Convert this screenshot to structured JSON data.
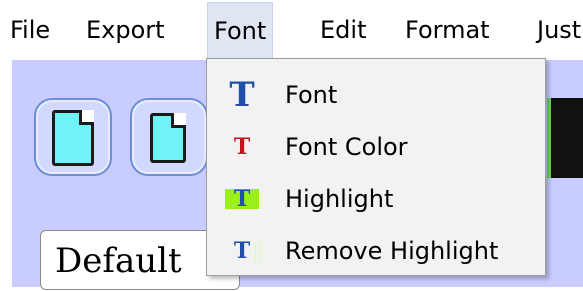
{
  "menubar": {
    "items": [
      "File",
      "Export",
      "Font",
      "Edit",
      "Format",
      "Just"
    ],
    "active_index": 2
  },
  "toolbar": {
    "buttons": [
      {
        "icon": "document-icon"
      },
      {
        "icon": "document-icon"
      }
    ]
  },
  "style_combo": {
    "value": "Default"
  },
  "font_menu": {
    "items": [
      {
        "label": "Font",
        "icon": "font-icon"
      },
      {
        "label": "Font Color",
        "icon": "font-color-icon"
      },
      {
        "label": "Highlight",
        "icon": "highlight-icon"
      },
      {
        "label": "Remove Highlight",
        "icon": "remove-highlight-icon"
      }
    ]
  },
  "colors": {
    "background": "#c9ccff",
    "menu_hover": "#dfe6f2",
    "dropdown_bg": "#f2f2f2",
    "font_icon_blue": "#1f4fa8",
    "font_color_icon_red": "#c4141b",
    "highlight_green": "#9cf01a",
    "document_cyan": "#6ff3f6"
  }
}
